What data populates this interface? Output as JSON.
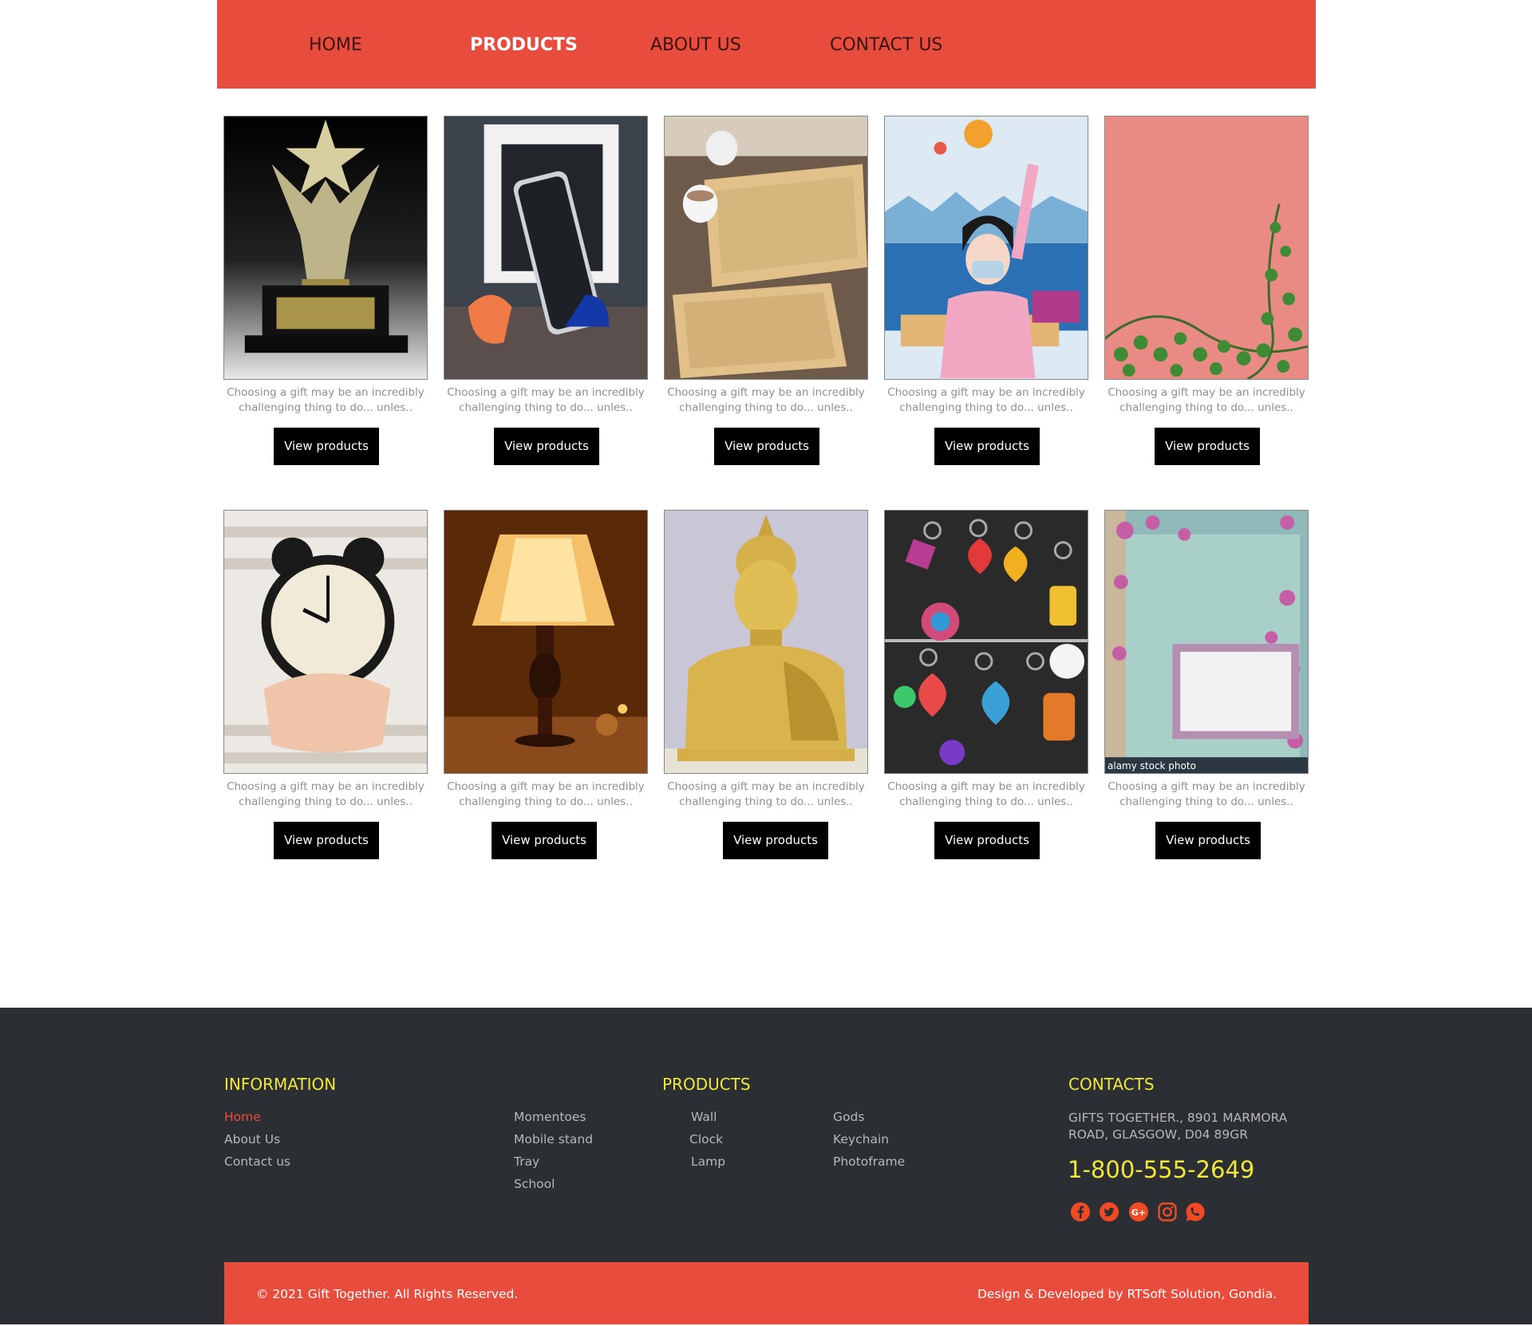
{
  "nav": {
    "items": [
      {
        "label": "HOME"
      },
      {
        "label": "PRODUCTS"
      },
      {
        "label": "ABOUT US"
      },
      {
        "label": "CONTACT US"
      }
    ],
    "active": "PRODUCTS"
  },
  "products": {
    "description": "Choosing a gift may be an incredibly challenging thing to do... unles..",
    "button_label": "View products",
    "items": [
      {
        "image": "trophy-star"
      },
      {
        "image": "mobile-stand"
      },
      {
        "image": "bamboo-tray"
      },
      {
        "image": "school-girl-masked"
      },
      {
        "image": "pink-wall-plant"
      },
      {
        "image": "alarm-clock"
      },
      {
        "image": "table-lamp"
      },
      {
        "image": "gold-buddha"
      },
      {
        "image": "beaded-keychains"
      },
      {
        "image": "floral-photoframe",
        "watermark": "alamy stock photo"
      }
    ]
  },
  "footer": {
    "information": {
      "heading": "INFORMATION",
      "links": [
        "Home",
        "About Us",
        "Contact us"
      ],
      "active": "Home"
    },
    "products": {
      "heading": "PRODUCTS",
      "col1": [
        "Momentoes",
        "Mobile stand",
        "Tray",
        "School"
      ],
      "col2": [
        "Wall",
        "Clock",
        "Lamp"
      ],
      "col3": [
        "Gods",
        "Keychain",
        "Photoframe"
      ]
    },
    "contacts": {
      "heading": "CONTACTS",
      "address": "GIFTS TOGETHER., 8901 MARMORA ROAD, GLASGOW, D04 89GR",
      "phone": "1-800-555-2649",
      "social": [
        "facebook-icon",
        "twitter-icon",
        "google-plus-icon",
        "instagram-icon",
        "whatsapp-icon"
      ]
    },
    "copyright": "© 2021 Gift Together. All Rights Reserved.",
    "credit": "Design & Developed by RTSoft Solution, Gondia."
  },
  "colors": {
    "accent": "#e84c3d",
    "footer_bg": "#2b2f33",
    "heading_yellow": "#f1e63a"
  }
}
